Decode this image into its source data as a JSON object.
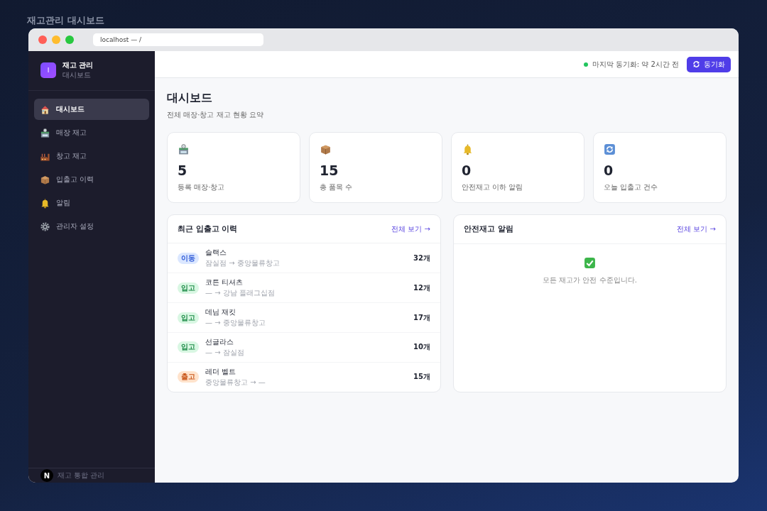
{
  "page_heading": "재고관리 대시보드",
  "browser": {
    "address": "localhost — /"
  },
  "sidebar": {
    "brand": {
      "logo": "I",
      "title": "재고 관리",
      "subtitle": "대시보드"
    },
    "items": [
      {
        "label": "대시보드",
        "selected": true
      },
      {
        "label": "매장 재고",
        "selected": false
      },
      {
        "label": "창고 재고",
        "selected": false
      },
      {
        "label": "입출고 이력",
        "selected": false
      },
      {
        "label": "알림",
        "selected": false
      },
      {
        "label": "관리자 설정",
        "selected": false
      }
    ],
    "footer": {
      "badge": "N",
      "text": "재고 통합 관리"
    }
  },
  "topbar": {
    "sync_status": "마지막 동기화: 약 2시간 전",
    "sync_button": "동기화"
  },
  "header": {
    "title": "대시보드",
    "subtitle": "전체 매장·창고 재고 현황 요약"
  },
  "stats": [
    {
      "value": "5",
      "label": "등록 매장·창고"
    },
    {
      "value": "15",
      "label": "총 품목 수"
    },
    {
      "value": "0",
      "label": "안전재고 이하 알림"
    },
    {
      "value": "0",
      "label": "오늘 입출고 건수"
    }
  ],
  "recent": {
    "title": "최근 입출고 이력",
    "link": "전체 보기 →",
    "rows": [
      {
        "kind": "move",
        "badge": "이동",
        "name": "슬랙스",
        "route": "잠실점 → 중앙물류창고",
        "qty": "32개"
      },
      {
        "kind": "in",
        "badge": "입고",
        "name": "코튼 티셔츠",
        "route": "— → 강남 플래그십점",
        "qty": "12개"
      },
      {
        "kind": "in",
        "badge": "입고",
        "name": "데님 재킷",
        "route": "— → 중앙물류창고",
        "qty": "17개"
      },
      {
        "kind": "in",
        "badge": "입고",
        "name": "선글라스",
        "route": "— → 잠실점",
        "qty": "10개"
      },
      {
        "kind": "out",
        "badge": "출고",
        "name": "레더 벨트",
        "route": "중앙물류창고 → —",
        "qty": "15개"
      }
    ]
  },
  "alerts": {
    "title": "안전재고 알림",
    "link": "전체 보기 →",
    "empty_message": "모든 재고가 안전 수준입니다."
  }
}
